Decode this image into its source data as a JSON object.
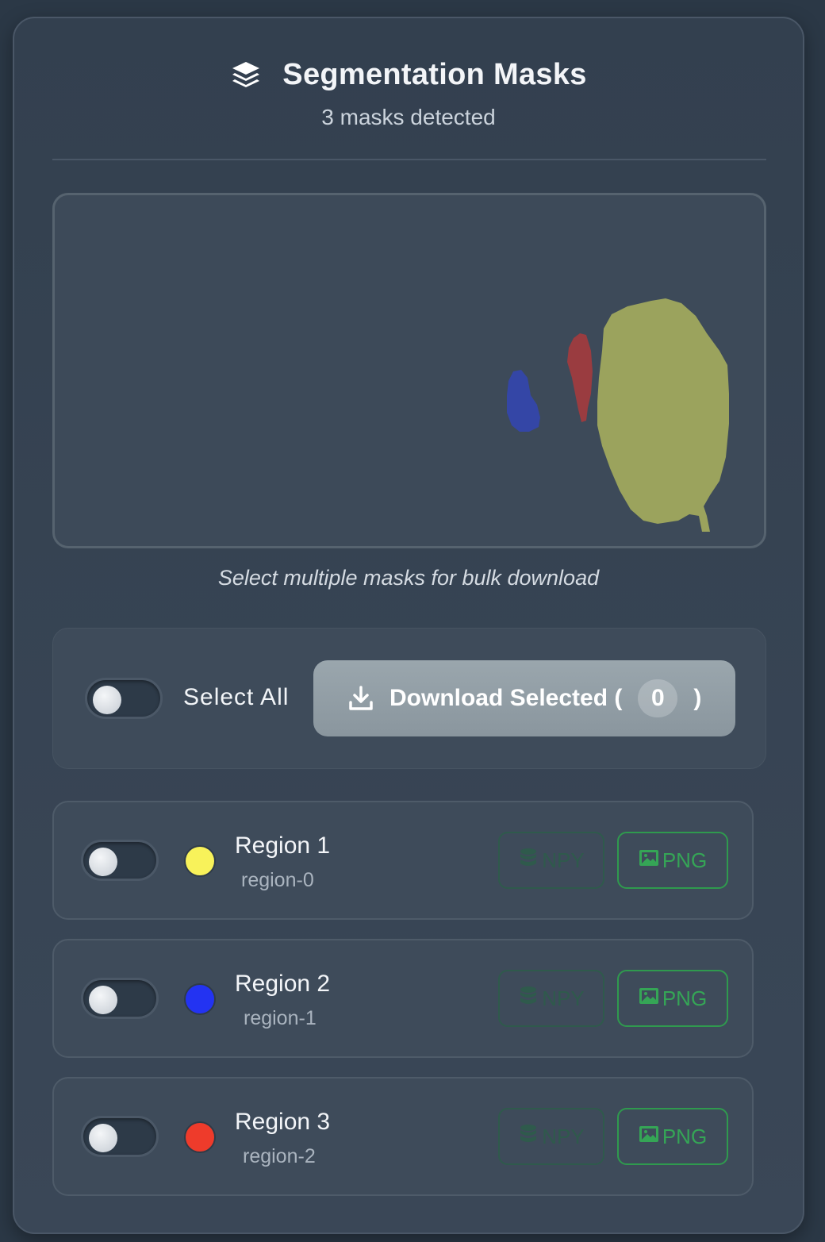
{
  "header": {
    "title": "Segmentation Masks",
    "subtitle": "3 masks detected",
    "icon": "layers-icon"
  },
  "preview": {
    "masks": [
      {
        "id": "region-0",
        "color": "#9ba35d"
      },
      {
        "id": "region-1",
        "color": "#3446a6"
      },
      {
        "id": "region-2",
        "color": "#9a3c40"
      }
    ]
  },
  "hint": "Select multiple masks for bulk download",
  "bulk": {
    "select_all_label": "Select All",
    "select_all_on": false,
    "download_label": "Download Selected (",
    "download_count": "0",
    "download_close": ")",
    "download_icon": "download-icon"
  },
  "regions": [
    {
      "title": "Region 1",
      "id": "region-0",
      "color": "#f8f25a",
      "selected": false,
      "npy_label": "NPY",
      "png_label": "PNG"
    },
    {
      "title": "Region 2",
      "id": "region-1",
      "color": "#2333f2",
      "selected": false,
      "npy_label": "NPY",
      "png_label": "PNG"
    },
    {
      "title": "Region 3",
      "id": "region-2",
      "color": "#ee3b2b",
      "selected": false,
      "npy_label": "NPY",
      "png_label": "PNG"
    }
  ],
  "colors": {
    "png_accent": "#35a556",
    "npy_accent_disabled": "#2f5a4c"
  }
}
